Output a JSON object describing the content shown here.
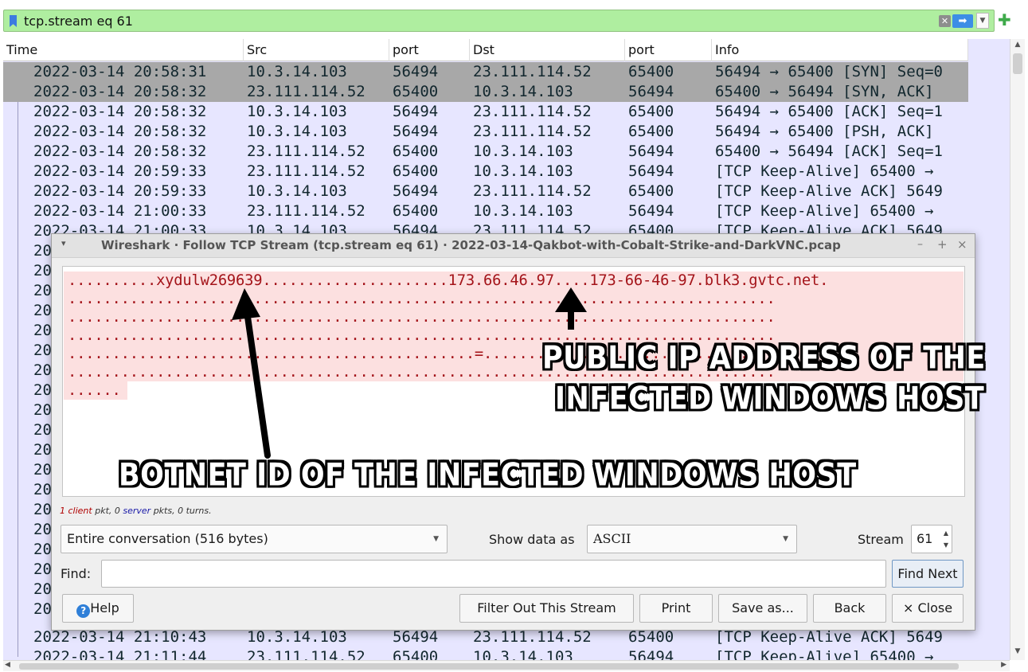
{
  "filter": {
    "text": "tcp.stream eq 61",
    "icons": [
      "bookmark-icon",
      "clear-icon",
      "apply-arrow-icon",
      "dropdown-icon",
      "add-filter-icon"
    ]
  },
  "packet_list": {
    "columns": [
      "Time",
      "Src",
      "port",
      "Dst",
      "port",
      "Info"
    ],
    "rows": [
      {
        "time": "2022-03-14 20:58:31",
        "src": "10.3.14.103",
        "sport": "56494",
        "dst": "23.111.114.52",
        "dport": "65400",
        "info": "56494 → 65400 [SYN] Seq=0"
      },
      {
        "time": "2022-03-14 20:58:32",
        "src": "23.111.114.52",
        "sport": "65400",
        "dst": "10.3.14.103",
        "dport": "56494",
        "info": "65400 → 56494 [SYN, ACK]"
      },
      {
        "time": "2022-03-14 20:58:32",
        "src": "10.3.14.103",
        "sport": "56494",
        "dst": "23.111.114.52",
        "dport": "65400",
        "info": "56494 → 65400 [ACK] Seq=1"
      },
      {
        "time": "2022-03-14 20:58:32",
        "src": "10.3.14.103",
        "sport": "56494",
        "dst": "23.111.114.52",
        "dport": "65400",
        "info": "56494 → 65400 [PSH, ACK]"
      },
      {
        "time": "2022-03-14 20:58:32",
        "src": "23.111.114.52",
        "sport": "65400",
        "dst": "10.3.14.103",
        "dport": "56494",
        "info": "65400 → 56494 [ACK] Seq=1"
      },
      {
        "time": "2022-03-14 20:59:33",
        "src": "23.111.114.52",
        "sport": "65400",
        "dst": "10.3.14.103",
        "dport": "56494",
        "info": "[TCP Keep-Alive] 65400 →"
      },
      {
        "time": "2022-03-14 20:59:33",
        "src": "10.3.14.103",
        "sport": "56494",
        "dst": "23.111.114.52",
        "dport": "65400",
        "info": "[TCP Keep-Alive ACK] 5649"
      },
      {
        "time": "2022-03-14 21:00:33",
        "src": "23.111.114.52",
        "sport": "65400",
        "dst": "10.3.14.103",
        "dport": "56494",
        "info": "[TCP Keep-Alive] 65400 →"
      },
      {
        "time": "2022-03-14 21:00:33",
        "src": "10.3.14.103",
        "sport": "56494",
        "dst": "23.111.114.52",
        "dport": "65400",
        "info": "[TCP Keep-Alive ACK] 5649"
      }
    ],
    "bottom_rows": [
      {
        "time": "2022-03-14 21:10:43",
        "src": "10.3.14.103",
        "sport": "56494",
        "dst": "23.111.114.52",
        "dport": "65400",
        "info": "[TCP Keep-Alive ACK] 5649"
      },
      {
        "time": "2022-03-14 21:11:44",
        "src": "23.111.114.52",
        "sport": "65400",
        "dst": "10.3.14.103",
        "dport": "56494",
        "info": "[TCP Keep-Alive] 65400 →"
      }
    ],
    "hidden_row_prefix": "20",
    "selected_rows": [
      0,
      1
    ],
    "colors": {
      "background": "#e7e6ff",
      "selected": "#a8a8a8"
    }
  },
  "dialog": {
    "title": "Wireshark · Follow TCP Stream (tcp.stream eq 61) · 2022-03-14-Qakbot-with-Cobalt-Strike-and-DarkVNC.pcap",
    "stream_lines": [
      "..........xydulw269639.....................173.66.46.97....173-66-46-97.blk3.gvtc.net.",
      "................................................................................",
      "................................................................................",
      "................................................................................",
      "..............................................=.................................",
      "................................................................................",
      "......"
    ],
    "summary": {
      "client_count": "1",
      "client_word": "client",
      "mid1": " pkt, ",
      "server_count": "0",
      "server_word": "server",
      "mid2": " pkts, 0 turns."
    },
    "conversation_select": "Entire conversation (516 bytes)",
    "show_data_label": "Show data as",
    "show_data_value": "ASCII",
    "stream_label": "Stream",
    "stream_value": "61",
    "find_label": "Find:",
    "find_value": "",
    "buttons": {
      "find_next": "Find Next",
      "help": "Help",
      "filter_out": "Filter Out This Stream",
      "print": "Print",
      "save_as": "Save as...",
      "back": "Back",
      "close": "Close"
    },
    "colors": {
      "client_text": "#a4141a",
      "client_bg": "#fce0e0"
    }
  },
  "annotations": {
    "ip_line1": "PUBLIC IP ADDRESS OF THE",
    "ip_line2": "INFECTED  WINDOWS HOST",
    "botnet": "BOTNET ID OF THE INFECTED WINDOWS HOST"
  }
}
